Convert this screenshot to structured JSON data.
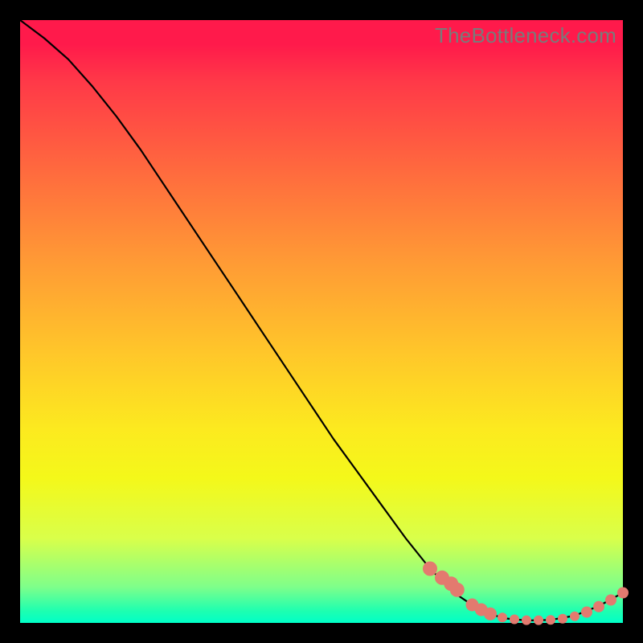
{
  "watermark": "TheBottleneck.com",
  "chart_data": {
    "type": "line",
    "title": "",
    "xlabel": "",
    "ylabel": "",
    "xlim": [
      0,
      100
    ],
    "ylim": [
      0,
      100
    ],
    "grid": false,
    "series": [
      {
        "name": "bottleneck-curve",
        "x": [
          0,
          4,
          8,
          12,
          16,
          20,
          24,
          28,
          32,
          36,
          40,
          44,
          48,
          52,
          56,
          60,
          64,
          68,
          72,
          76,
          80,
          84,
          88,
          92,
          96,
          100
        ],
        "y": [
          100.0,
          97.0,
          93.5,
          89.0,
          84.0,
          78.5,
          72.5,
          66.5,
          60.5,
          54.5,
          48.5,
          42.5,
          36.5,
          30.5,
          25.0,
          19.5,
          14.0,
          9.0,
          5.0,
          2.3,
          0.8,
          0.4,
          0.5,
          1.2,
          2.8,
          5.0
        ]
      }
    ],
    "markers": {
      "name": "highlight-points",
      "x": [
        68.0,
        70.0,
        71.5,
        72.5,
        75.0,
        76.5,
        78.0,
        80.0,
        82.0,
        84.0,
        86.0,
        88.0,
        90.0,
        92.0,
        94.0,
        96.0,
        98.0,
        100.0
      ],
      "y": [
        9.0,
        7.5,
        6.5,
        5.5,
        3.0,
        2.2,
        1.5,
        0.9,
        0.6,
        0.45,
        0.45,
        0.5,
        0.7,
        1.1,
        1.8,
        2.7,
        3.8,
        5.0
      ],
      "r": [
        9,
        9,
        9,
        9,
        8,
        8,
        8,
        6,
        6,
        6,
        6,
        6,
        6,
        6,
        7,
        7,
        7,
        7
      ]
    }
  }
}
